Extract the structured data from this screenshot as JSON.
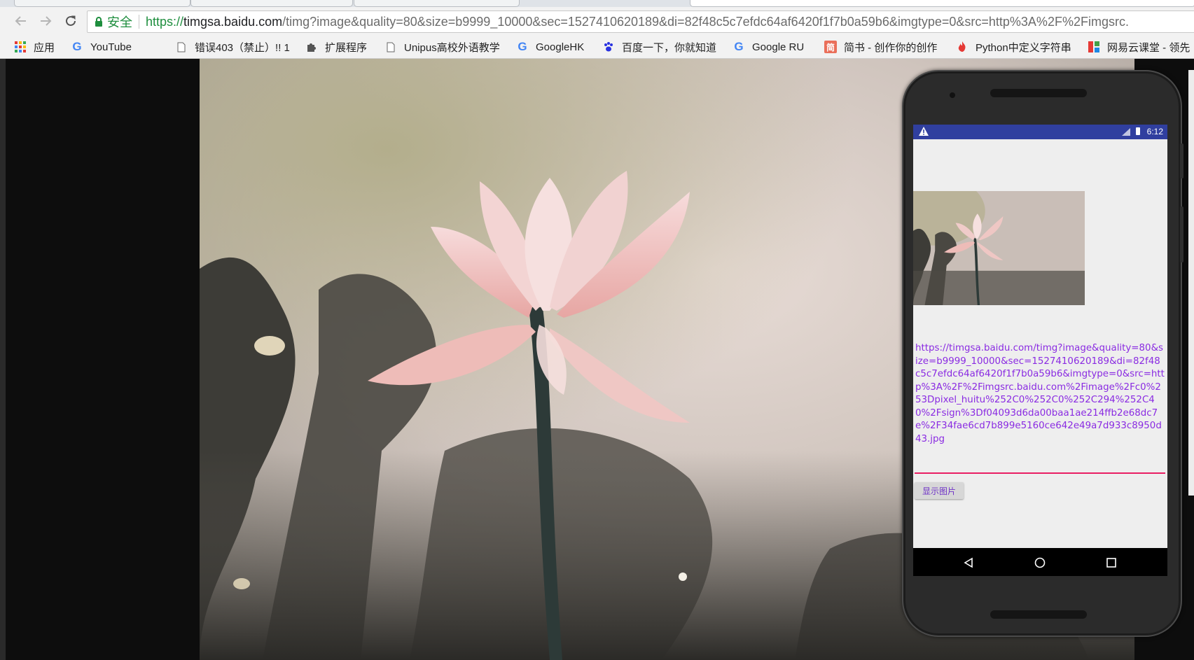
{
  "browser": {
    "omnibox": {
      "secure_label": "安全",
      "url_scheme": "https://",
      "url_host": "timgsa.baidu.com",
      "url_path": "/timg?image&quality=80&size=b9999_10000&sec=1527410620189&di=82f48c5c7efdc64af6420f1f7b0a59b6&imgtype=0&src=http%3A%2F%2Fimgsrc.",
      "secure_color": "#1e8e3e"
    },
    "bookmarks": [
      {
        "label": "应用",
        "icon": "apps-grid-icon"
      },
      {
        "label": "YouTube",
        "icon": "google-g-icon"
      },
      {
        "label": "错误403（禁止）!! 1",
        "icon": "page-icon"
      },
      {
        "label": "扩展程序",
        "icon": "puzzle-icon"
      },
      {
        "label": "Unipus高校外语教学",
        "icon": "page-icon"
      },
      {
        "label": "GoogleHK",
        "icon": "google-g-icon"
      },
      {
        "label": "百度一下，你就知道",
        "icon": "baidu-paw-icon"
      },
      {
        "label": "Google  RU",
        "icon": "google-g-icon"
      },
      {
        "label": "简书 - 创作你的创作",
        "icon": "jianshu-icon"
      },
      {
        "label": "Python中定义字符串",
        "icon": "flame-icon"
      },
      {
        "label": "网易云课堂 - 领先",
        "icon": "netease-icon"
      }
    ]
  },
  "emulator": {
    "status_time": "6:12",
    "url_text": "https://timgsa.baidu.com/timg?image&quality=80&size=b9999_10000&sec=1527410620189&di=82f48c5c7efdc64af6420f1f7b0a59b6&imgtype=0&src=http%3A%2F%2Fimgsrc.baidu.com%2Fimage%2Fc0%253Dpixel_huitu%252C0%252C0%252C294%252C40%2Fsign%3Df04093d6da00baa1ae214ffb2e68dc7e%2F34fae6cd7b899e5160ce642e49a7d933c8950d43.jpg",
    "show_button_label": "显示图片",
    "status_bar_color": "#303f9f",
    "accent_color": "#e91e63"
  }
}
